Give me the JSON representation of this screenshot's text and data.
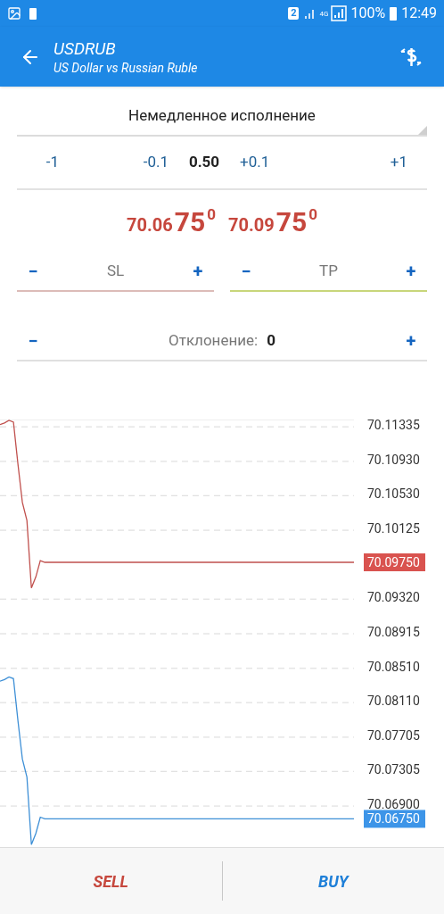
{
  "status_bar": {
    "sim": "2",
    "network": "4G",
    "battery": "100%",
    "time": "12:49"
  },
  "header": {
    "title": "USDRUB",
    "subtitle": "US Dollar vs Russian Ruble"
  },
  "order_type": {
    "value": "Немедленное исполнение"
  },
  "volume": {
    "value": "0.50",
    "decrease": [
      "-1",
      "-0.1"
    ],
    "increase": [
      "+0.1",
      "+1"
    ]
  },
  "prices": [
    {
      "prefix": "70.06",
      "big": "75",
      "point": "0"
    },
    {
      "prefix": "70.09",
      "big": "75",
      "point": "0"
    }
  ],
  "stops": [
    {
      "placeholder": "SL",
      "color": "#dcbcb8",
      "minus": "−",
      "plus": "+"
    },
    {
      "placeholder": "TP",
      "color": "#c8d67a",
      "minus": "−",
      "plus": "+"
    }
  ],
  "deviation": {
    "label": "Отклонение:",
    "value": "0",
    "minus": "−",
    "plus": "+"
  },
  "chart": {
    "chart_data": {
      "type": "line",
      "grid": true,
      "ylim": [
        70.0641,
        70.1142
      ],
      "categories": [
        null,
        null,
        null,
        null,
        null,
        null,
        null,
        null,
        null,
        null,
        null,
        null,
        null,
        null,
        null,
        null,
        null,
        null,
        null,
        null,
        null,
        null,
        null,
        null,
        null,
        null,
        null,
        null,
        null,
        null,
        null,
        null,
        null,
        null,
        null,
        null,
        null,
        null,
        null,
        null,
        null,
        null,
        null,
        null,
        null,
        null,
        null,
        null,
        null,
        null,
        null,
        null,
        null,
        null,
        null,
        null,
        null,
        null,
        null,
        null,
        null,
        null,
        null,
        null,
        null,
        null,
        null,
        null,
        null,
        null,
        null,
        null,
        null,
        null,
        null,
        null,
        null,
        null,
        null,
        null
      ],
      "series": [
        {
          "color": "#c0504d",
          "values": [
            70.1136,
            70.1138,
            70.1141,
            70.1139,
            70.109,
            70.1045,
            70.1024,
            70.0945,
            70.0958,
            70.0977,
            70.0975,
            70.0975,
            70.0975,
            70.0975,
            70.0975,
            70.0975,
            70.0975,
            70.0975,
            70.0975,
            70.0975,
            70.0975,
            70.0975,
            70.0975,
            70.0975,
            70.0975,
            70.0975,
            70.0975,
            70.0975,
            70.0975,
            70.0975,
            70.0975,
            70.0975,
            70.0975,
            70.0975,
            70.0975,
            70.0975,
            70.0975,
            70.0975,
            70.0975,
            70.0975,
            70.0975,
            70.0975,
            70.0975,
            70.0975,
            70.0975,
            70.0975,
            70.0975,
            70.0975,
            70.0975,
            70.0975,
            70.0975,
            70.0975,
            70.0975,
            70.0975,
            70.0975,
            70.0975,
            70.0975,
            70.0975,
            70.0975,
            70.0975,
            70.0975,
            70.0975,
            70.0975,
            70.0975,
            70.0975,
            70.0975,
            70.0975,
            70.0975,
            70.0975,
            70.0975,
            70.0975,
            70.0975,
            70.0975,
            70.0975,
            70.0975,
            70.0975,
            70.0975,
            70.0975,
            70.0975,
            70.0975
          ]
        },
        {
          "color": "#3d8fd6",
          "values": [
            70.0836,
            70.0838,
            70.0841,
            70.0839,
            70.079,
            70.0745,
            70.0724,
            70.0645,
            70.0658,
            70.0677,
            70.0675,
            70.0675,
            70.0675,
            70.0675,
            70.0675,
            70.0675,
            70.0675,
            70.0675,
            70.0675,
            70.0675,
            70.0675,
            70.0675,
            70.0675,
            70.0675,
            70.0675,
            70.0675,
            70.0675,
            70.0675,
            70.0675,
            70.0675,
            70.0675,
            70.0675,
            70.0675,
            70.0675,
            70.0675,
            70.0675,
            70.0675,
            70.0675,
            70.0675,
            70.0675,
            70.0675,
            70.0675,
            70.0675,
            70.0675,
            70.0675,
            70.0675,
            70.0675,
            70.0675,
            70.0675,
            70.0675,
            70.0675,
            70.0675,
            70.0675,
            70.0675,
            70.0675,
            70.0675,
            70.0675,
            70.0675,
            70.0675,
            70.0675,
            70.0675,
            70.0675,
            70.0675,
            70.0675,
            70.0675,
            70.0675,
            70.0675,
            70.0675,
            70.0675,
            70.0675,
            70.0675,
            70.0675,
            70.0675,
            70.0675,
            70.0675,
            70.0675,
            70.0675,
            70.0675,
            70.0675,
            70.0675
          ]
        }
      ],
      "yticks": [
        {
          "value": 70.11335,
          "label": "70.11335"
        },
        {
          "value": 70.1093,
          "label": "70.10930"
        },
        {
          "value": 70.1053,
          "label": "70.10530"
        },
        {
          "value": 70.10125,
          "label": "70.10125"
        },
        {
          "value": 70.0932,
          "label": "70.09320"
        },
        {
          "value": 70.08915,
          "label": "70.08915"
        },
        {
          "value": 70.0851,
          "label": "70.08510"
        },
        {
          "value": 70.0811,
          "label": "70.08110"
        },
        {
          "value": 70.07705,
          "label": "70.07705"
        },
        {
          "value": 70.07305,
          "label": "70.07305"
        },
        {
          "value": 70.069,
          "label": "70.06900"
        }
      ],
      "annotations": [
        "70.09750",
        "70.06750"
      ]
    }
  },
  "actions": [
    {
      "label": "SELL",
      "kind": "sell"
    },
    {
      "label": "BUY",
      "kind": "buy"
    }
  ]
}
